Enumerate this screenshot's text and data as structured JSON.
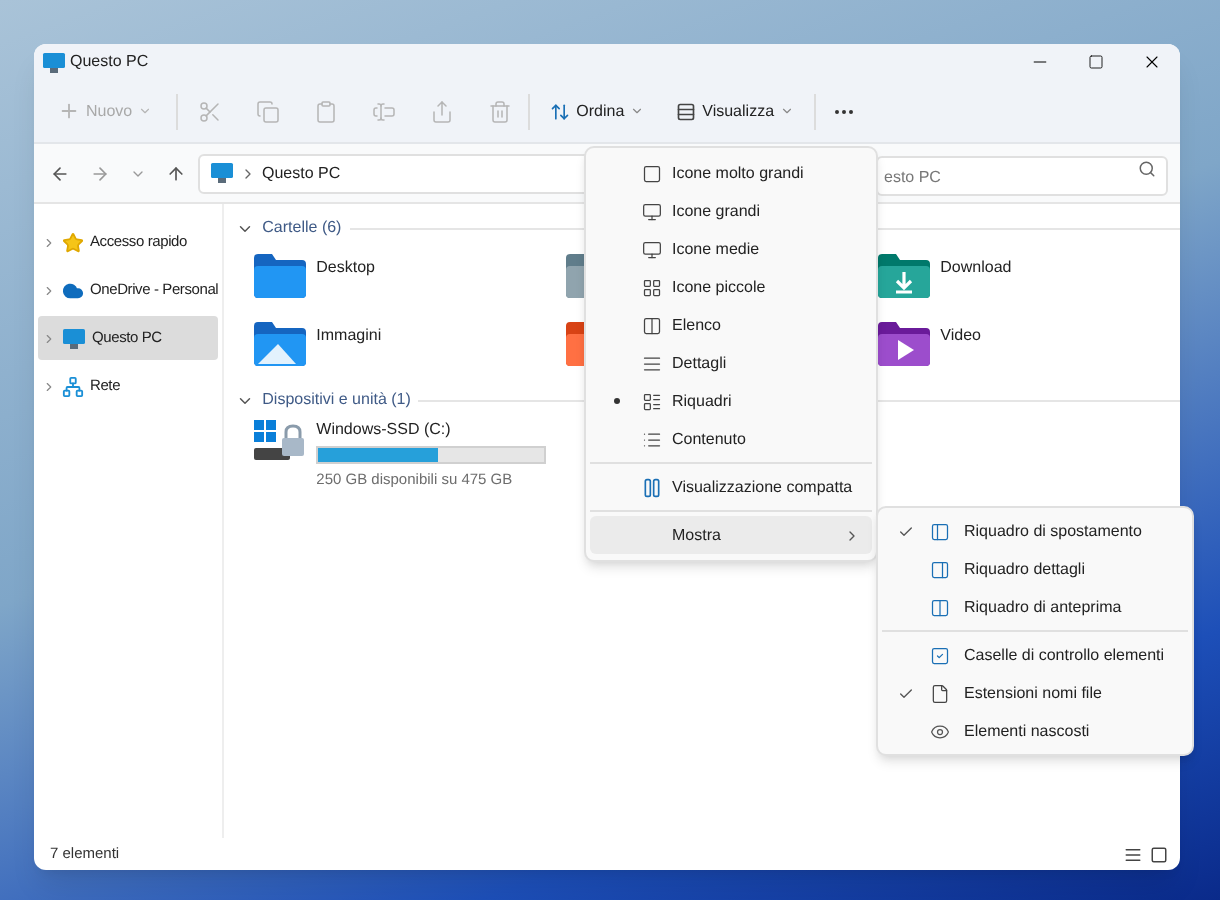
{
  "window": {
    "title": "Questo PC"
  },
  "toolbar": {
    "new_button": "Nuovo",
    "sort_button": "Ordina",
    "view_button": "Visualizza"
  },
  "address_bar": {
    "path": "Questo PC",
    "search_placeholder": "esto PC"
  },
  "sidebar": {
    "items": [
      {
        "label": "Accesso rapido",
        "kind": "star",
        "selected": false
      },
      {
        "label": "OneDrive - Personal",
        "kind": "cloud",
        "selected": false
      },
      {
        "label": "Questo PC",
        "kind": "pc",
        "selected": true
      },
      {
        "label": "Rete",
        "kind": "network",
        "selected": false
      }
    ]
  },
  "folders_section": {
    "title": "Cartelle (6)",
    "expanded": true,
    "folders": [
      {
        "name": "Desktop",
        "kind": "desktop"
      },
      {
        "kind": "documents"
      },
      {
        "name": "Download",
        "kind": "downloads"
      },
      {
        "name": "Immagini",
        "kind": "pictures"
      },
      {
        "kind": "music"
      },
      {
        "name": "Video",
        "kind": "videos"
      }
    ]
  },
  "drives_section": {
    "title": "Dispositivi e unità (1)",
    "expanded": true,
    "drives": [
      {
        "name": "Windows-SSD (C:)",
        "level": 0.53,
        "reading": "250 GB disponibili su 475 GB"
      }
    ]
  },
  "status_bar": {
    "count": "7 elementi"
  },
  "view_menu": {
    "items": [
      {
        "label": "Icone molto grandi",
        "kind": "xl",
        "selected": false
      },
      {
        "label": "Icone grandi",
        "kind": "large",
        "selected": false
      },
      {
        "label": "Icone medie",
        "kind": "medium",
        "selected": false
      },
      {
        "label": "Icone piccole",
        "kind": "small",
        "selected": false
      },
      {
        "label": "Elenco",
        "kind": "list",
        "selected": false
      },
      {
        "label": "Dettagli",
        "kind": "details",
        "selected": false
      },
      {
        "label": "Riquadri",
        "kind": "tiles",
        "selected": true
      },
      {
        "label": "Contenuto",
        "kind": "content",
        "selected": false
      }
    ],
    "compact_item": {
      "label": "Visualizzazione compatta"
    },
    "show_item": {
      "label": "Mostra",
      "expanded": true
    }
  },
  "show_submenu": {
    "groups": [
      {
        "items": [
          {
            "label": "Riquadro di spostamento",
            "kind": "nav",
            "checked": true
          },
          {
            "label": "Riquadro dettagli",
            "kind": "details",
            "checked": false
          },
          {
            "label": "Riquadro di anteprima",
            "kind": "preview",
            "checked": false
          }
        ]
      },
      {
        "items": [
          {
            "label": "Caselle di controllo elementi",
            "kind": "checkboxes",
            "checked": false
          },
          {
            "label": "Estensioni nomi file",
            "kind": "extensions",
            "checked": true
          },
          {
            "label": "Elementi nascosti",
            "kind": "hidden",
            "checked": false
          }
        ]
      }
    ]
  }
}
